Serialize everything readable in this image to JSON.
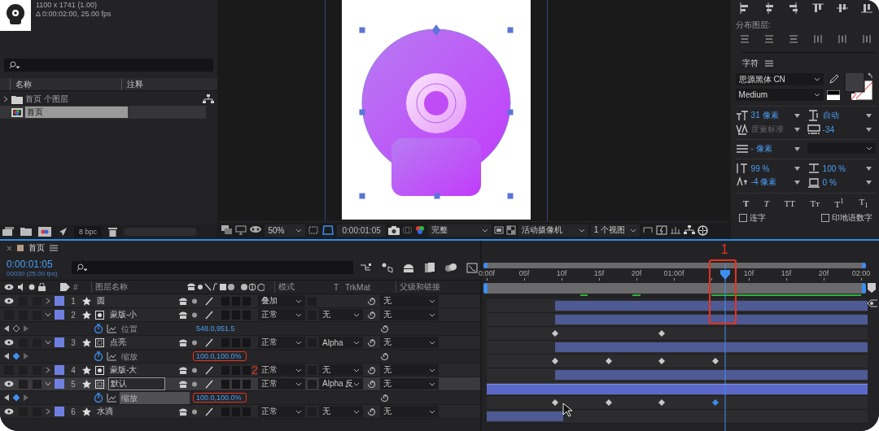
{
  "project": {
    "info_lines": [
      "1100 x 1741 (1.00)",
      "Δ 0:00:02:00, 25.00 fps"
    ],
    "columns": [
      "名称",
      "注释"
    ],
    "items": [
      {
        "kind": "folder",
        "label": "首页 个图层",
        "expanded": false,
        "selected": false
      },
      {
        "kind": "composition",
        "label": "首页",
        "selected": true
      }
    ],
    "bit_depth": "8 bpc"
  },
  "viewer": {
    "zoom": "50%",
    "timecode": "0:00:01:05",
    "resolution": "完整",
    "camera": "活动摄像机",
    "views": "1 个视图"
  },
  "character": {
    "distribute_label": "分布图层:",
    "title": "字符",
    "font_family": "思源黑体 CN",
    "font_style": "Medium",
    "metrics": [
      {
        "kind": "font-size",
        "value": "31 像素",
        "disabled": false
      },
      {
        "kind": "leading",
        "value": "自动",
        "disabled": false
      },
      {
        "kind": "kerning",
        "value": "度量标准",
        "disabled": true
      },
      {
        "kind": "tracking",
        "value": "-34",
        "disabled": false
      },
      {
        "kind": "stroke",
        "value": "- 像素",
        "disabled": false
      },
      {
        "kind": "vertical-scale",
        "value": "99 %",
        "disabled": false
      },
      {
        "kind": "horizontal-scale",
        "value": "100 %",
        "disabled": false
      },
      {
        "kind": "baseline-shift",
        "value": "-4 像素",
        "disabled": false
      },
      {
        "kind": "tsume",
        "value": "0 %",
        "disabled": false
      }
    ],
    "styles": [
      {
        "kind": "bold",
        "label": "T"
      },
      {
        "kind": "italic",
        "label": "T"
      },
      {
        "kind": "caps",
        "label": "TT"
      },
      {
        "kind": "small-caps",
        "label": "Tт"
      },
      {
        "kind": "super",
        "label": "T$^{1}$"
      },
      {
        "kind": "sub",
        "label": "T$_{1}$"
      }
    ],
    "checkboxes": [
      {
        "label": "连字",
        "checked": false
      },
      {
        "label": "印地语数字",
        "checked": false
      }
    ]
  },
  "timeline": {
    "tab": "首页",
    "timecode": "0:00:01:05",
    "frame_info": "00030 (25.00 fps)",
    "columns": {
      "number": "#",
      "name": "图层名称",
      "mode": "模式",
      "t": "T",
      "trkmat": "TrkMat",
      "parent": "父级和链接"
    },
    "ruler": [
      "0:00f",
      "05f",
      "10f",
      "15f",
      "20f",
      "01:00f",
      "10f",
      "15f",
      "20f",
      "02:00"
    ],
    "playhead": {
      "level": 0.6,
      "highlighted": true,
      "callout": "1"
    },
    "value_callout": "2",
    "rows": [
      {
        "kind": "layer",
        "number": "1",
        "name": "圆",
        "visible": true,
        "expanded": false,
        "selected": false,
        "mode": "叠加",
        "parent": "无"
      },
      {
        "kind": "layer",
        "number": "2",
        "name": "蒙版-小",
        "visible": false,
        "expanded": true,
        "selected": false,
        "mode": "正常",
        "trkmat": "无",
        "parent": "无"
      },
      {
        "kind": "property",
        "name": "位置",
        "value": "548.0,951.5",
        "at_keyframe": false,
        "highlighted": false,
        "selected": false,
        "keyframes": [
          {
            "level": 0.18,
            "selected": false
          },
          {
            "level": 0.46,
            "selected": false
          }
        ]
      },
      {
        "kind": "layer",
        "number": "3",
        "name": "点亮",
        "visible": true,
        "expanded": true,
        "selected": false,
        "mode": "正常",
        "trkmat": "Alpha",
        "parent": "无"
      },
      {
        "kind": "property",
        "name": "缩放",
        "value": "100.0,100.0%",
        "at_keyframe": true,
        "highlighted": true,
        "selected": false,
        "keyframes": [
          {
            "level": 0.18,
            "selected": false
          },
          {
            "level": 0.32,
            "selected": false
          },
          {
            "level": 0.46,
            "selected": false
          },
          {
            "level": 0.6,
            "selected": false
          }
        ]
      },
      {
        "kind": "layer",
        "number": "4",
        "name": "蒙版-大",
        "visible": false,
        "expanded": false,
        "selected": false,
        "mode": "正常",
        "trkmat": "无",
        "parent": "无"
      },
      {
        "kind": "layer",
        "number": "5",
        "name": "默认",
        "visible": true,
        "expanded": true,
        "selected": true,
        "mode": "正常",
        "trkmat": "Alpha 反",
        "parent": "无"
      },
      {
        "kind": "property",
        "name": "缩放",
        "value": "100.0,100.0%",
        "at_keyframe": true,
        "highlighted": true,
        "selected": true,
        "keyframes": [
          {
            "level": 0.18,
            "selected": false
          },
          {
            "level": 0.32,
            "selected": false
          },
          {
            "level": 0.46,
            "selected": false
          },
          {
            "level": 0.6,
            "selected": true
          }
        ]
      },
      {
        "kind": "layer",
        "number": "6",
        "name": "水滴",
        "visible": true,
        "expanded": false,
        "selected": false,
        "mode": "正常",
        "trkmat": "无",
        "parent": "无"
      }
    ]
  }
}
